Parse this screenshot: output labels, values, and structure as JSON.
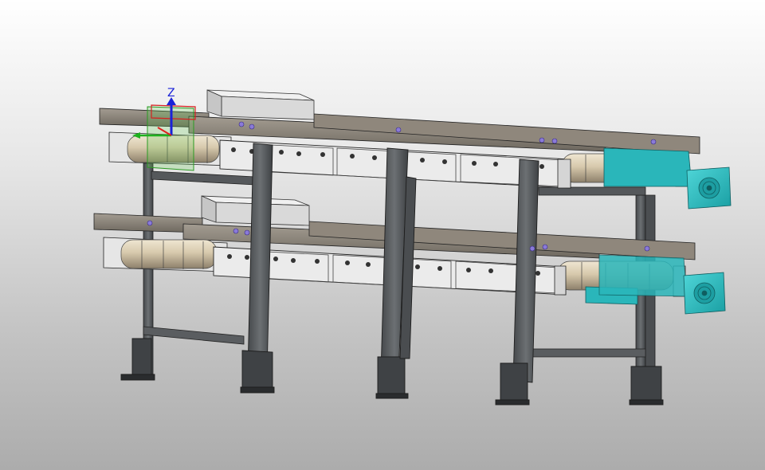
{
  "viewport": {
    "background_top": "#ffffff",
    "background_bottom": "#acacac"
  },
  "triad": {
    "z_label": "Z",
    "x_color": "#e02020",
    "y_color": "#1fb01f",
    "z_color": "#1a22d8"
  },
  "model": {
    "frame_color": "#5a5d60",
    "rail_color": "#8a8278",
    "side_plate_color": "#e4e4e4",
    "roller_color": "#cdbfa3",
    "motor_color": "#25bcc0",
    "bin_color": "#e3e3e3",
    "icons": [
      "coordinate-triad-icon",
      "constraint-marker-icon",
      "motor-icon"
    ]
  }
}
